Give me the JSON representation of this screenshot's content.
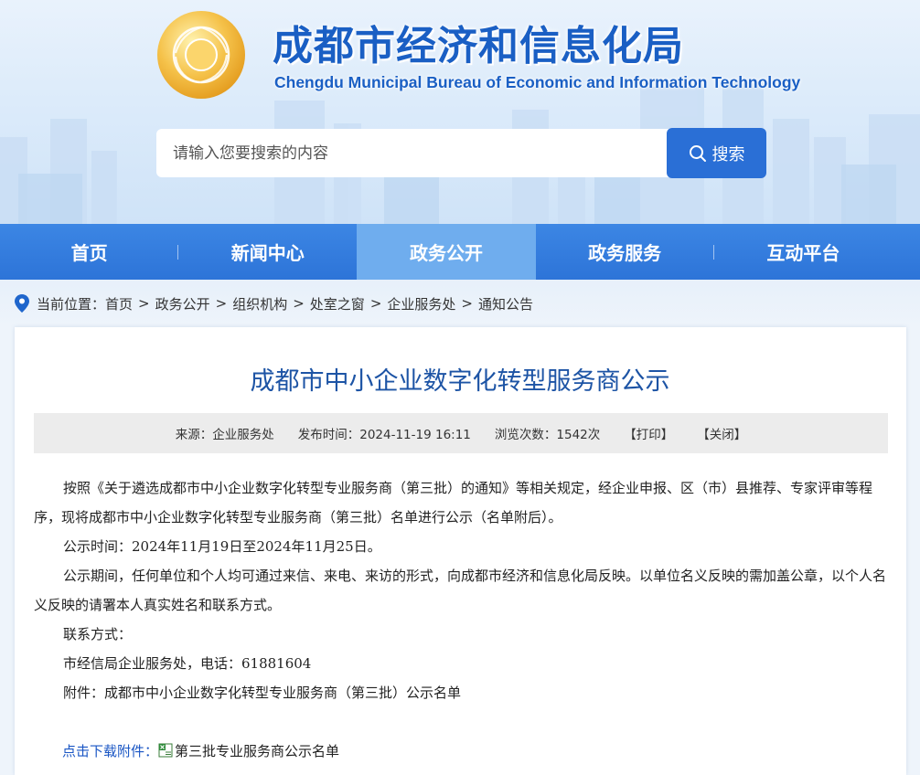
{
  "header": {
    "title": "成都市经济和信息化局",
    "subtitle": "Chengdu Municipal Bureau of Economic and Information Technology",
    "emblem_icon": "city-emblem-icon"
  },
  "search": {
    "placeholder": "请输入您要搜索的内容",
    "button_label": "搜索"
  },
  "nav": {
    "items": [
      {
        "label": "首页"
      },
      {
        "label": "新闻中心"
      },
      {
        "label": "政务公开"
      },
      {
        "label": "政务服务"
      },
      {
        "label": "互动平台"
      }
    ],
    "active_index": 2
  },
  "breadcrumb": {
    "prefix": "当前位置：",
    "items": [
      "首页",
      "政务公开",
      "组织机构",
      "处室之窗",
      "企业服务处",
      "通知公告"
    ],
    "separator": ">"
  },
  "article": {
    "title": "成都市中小企业数字化转型服务商公示",
    "meta": {
      "source": "来源：企业服务处",
      "publish_time": "发布时间：2024-11-19 16:11",
      "views": "浏览次数：1542次",
      "print": "【打印】",
      "close": "【关闭】"
    },
    "paragraphs": [
      "按照《关于遴选成都市中小企业数字化转型专业服务商（第三批）的通知》等相关规定，经企业申报、区（市）县推荐、专家评审等程序，现将成都市中小企业数字化转型专业服务商（第三批）名单进行公示（名单附后）。",
      "公示时间：2024年11月19日至2024年11月25日。",
      "公示期间，任何单位和个人均可通过来信、来电、来访的形式，向成都市经济和信息化局反映。以单位名义反映的需加盖公章，以个人名义反映的请署本人真实姓名和联系方式。",
      "联系方式：",
      "市经信局企业服务处，电话：61881604",
      "附件：成都市中小企业数字化转型专业服务商（第三批）公示名单"
    ],
    "attachment": {
      "label": "点击下载附件：",
      "file_name": "第三批专业服务商公示名单",
      "file_icon": "excel-file-icon"
    }
  },
  "colors": {
    "brand_blue": "#1a5fc4",
    "nav_bg": "#2d74d8",
    "nav_active": "#6fadee",
    "search_button": "#2a6fd6",
    "title_blue": "#1d54a5"
  }
}
